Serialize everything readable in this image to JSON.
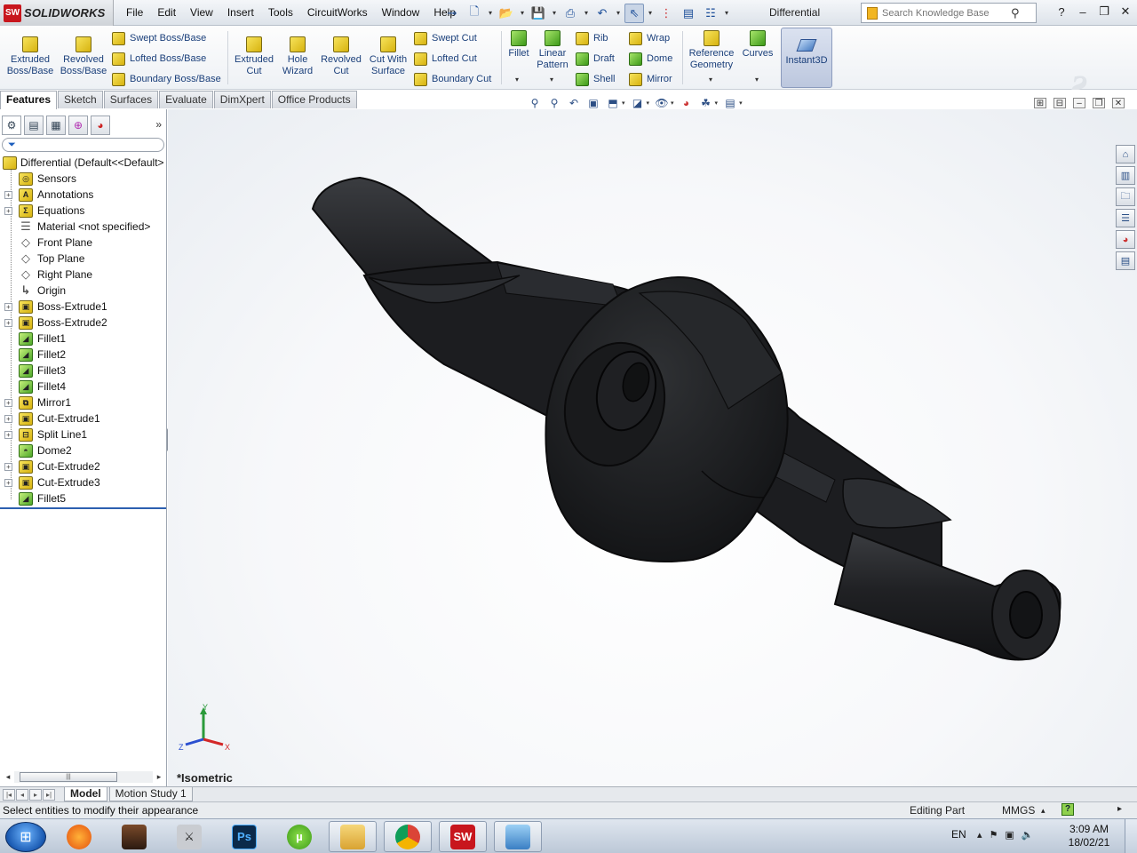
{
  "titlebar": {
    "app_name": "SOLIDWORKS",
    "logo_glyph": "SW",
    "menus": [
      "File",
      "Edit",
      "View",
      "Insert",
      "Tools",
      "CircuitWorks",
      "Window",
      "Help"
    ],
    "document_title": "Differential",
    "search_placeholder": "Search Knowledge Base",
    "quick_access_icons": [
      "pin-icon",
      "new-document-icon",
      "open-icon",
      "save-icon",
      "print-icon",
      "undo-icon",
      "select-icon",
      "traffic-light-icon",
      "file-properties-icon",
      "options-icon"
    ]
  },
  "command_manager": {
    "extruded_boss": "Extruded Boss/Base",
    "revolved_boss": "Revolved Boss/Base",
    "swept_boss": "Swept Boss/Base",
    "lofted_boss": "Lofted Boss/Base",
    "boundary_boss": "Boundary Boss/Base",
    "extruded_cut": "Extruded Cut",
    "hole_wizard": "Hole Wizard",
    "revolved_cut": "Revolved Cut",
    "cut_with_surface": "Cut With Surface",
    "swept_cut": "Swept Cut",
    "lofted_cut": "Lofted Cut",
    "boundary_cut": "Boundary Cut",
    "fillet": "Fillet",
    "linear_pattern": "Linear Pattern",
    "rib": "Rib",
    "draft": "Draft",
    "shell": "Shell",
    "wrap": "Wrap",
    "dome": "Dome",
    "mirror": "Mirror",
    "reference_geometry": "Reference Geometry",
    "curves": "Curves",
    "instant3d": "Instant3D"
  },
  "tabs": [
    "Features",
    "Sketch",
    "Surfaces",
    "Evaluate",
    "DimXpert",
    "Office Products"
  ],
  "active_tab": "Features",
  "feature_tree": {
    "root": "Differential  (Default<<Default>",
    "items": [
      {
        "label": "Sensors",
        "icon": "sensor-icon",
        "expandable": false
      },
      {
        "label": "Annotations",
        "icon": "annotations-icon",
        "expandable": true
      },
      {
        "label": "Equations",
        "icon": "equations-icon",
        "expandable": true
      },
      {
        "label": "Material <not specified>",
        "icon": "material-icon",
        "expandable": false
      },
      {
        "label": "Front Plane",
        "icon": "plane-icon",
        "expandable": false
      },
      {
        "label": "Top Plane",
        "icon": "plane-icon",
        "expandable": false
      },
      {
        "label": "Right Plane",
        "icon": "plane-icon",
        "expandable": false
      },
      {
        "label": "Origin",
        "icon": "origin-icon",
        "expandable": false
      },
      {
        "label": "Boss-Extrude1",
        "icon": "extrude-icon",
        "expandable": true
      },
      {
        "label": "Boss-Extrude2",
        "icon": "extrude-icon",
        "expandable": true
      },
      {
        "label": "Fillet1",
        "icon": "fillet-icon",
        "expandable": false
      },
      {
        "label": "Fillet2",
        "icon": "fillet-icon",
        "expandable": false
      },
      {
        "label": "Fillet3",
        "icon": "fillet-icon",
        "expandable": false
      },
      {
        "label": "Fillet4",
        "icon": "fillet-icon",
        "expandable": false
      },
      {
        "label": "Mirror1",
        "icon": "mirror-icon",
        "expandable": true
      },
      {
        "label": "Cut-Extrude1",
        "icon": "cut-extrude-icon",
        "expandable": true
      },
      {
        "label": "Split Line1",
        "icon": "split-line-icon",
        "expandable": true
      },
      {
        "label": "Dome2",
        "icon": "dome-icon",
        "expandable": false
      },
      {
        "label": "Cut-Extrude2",
        "icon": "cut-extrude-icon",
        "expandable": true
      },
      {
        "label": "Cut-Extrude3",
        "icon": "cut-extrude-icon",
        "expandable": true
      },
      {
        "label": "Fillet5",
        "icon": "fillet-icon",
        "expandable": false
      }
    ]
  },
  "viewport": {
    "view_name": "*Isometric",
    "triad": {
      "x": "X",
      "y": "Y",
      "z": "Z"
    },
    "model_color": "#1e1f21"
  },
  "bottom_tabs": [
    "Model",
    "Motion Study 1"
  ],
  "status": {
    "message": "Select entities to modify their appearance",
    "mode": "Editing Part",
    "units": "MMGS",
    "help": "?"
  },
  "taskbar": {
    "apps": [
      "windows-explorer-folder",
      "firefox",
      "game-character",
      "counter-strike",
      "photoshop",
      "utorrent",
      "file-explorer",
      "chrome",
      "solidworks",
      "image-viewer"
    ],
    "ps_label": "Ps",
    "sw_label": "SW",
    "language": "EN",
    "time": "3:09 AM",
    "date": "18/02/21"
  },
  "colors": {
    "accent": "#2d5fb0",
    "tree_icon_yellow": "#e4c43a",
    "tree_icon_green": "#7bc94a"
  }
}
